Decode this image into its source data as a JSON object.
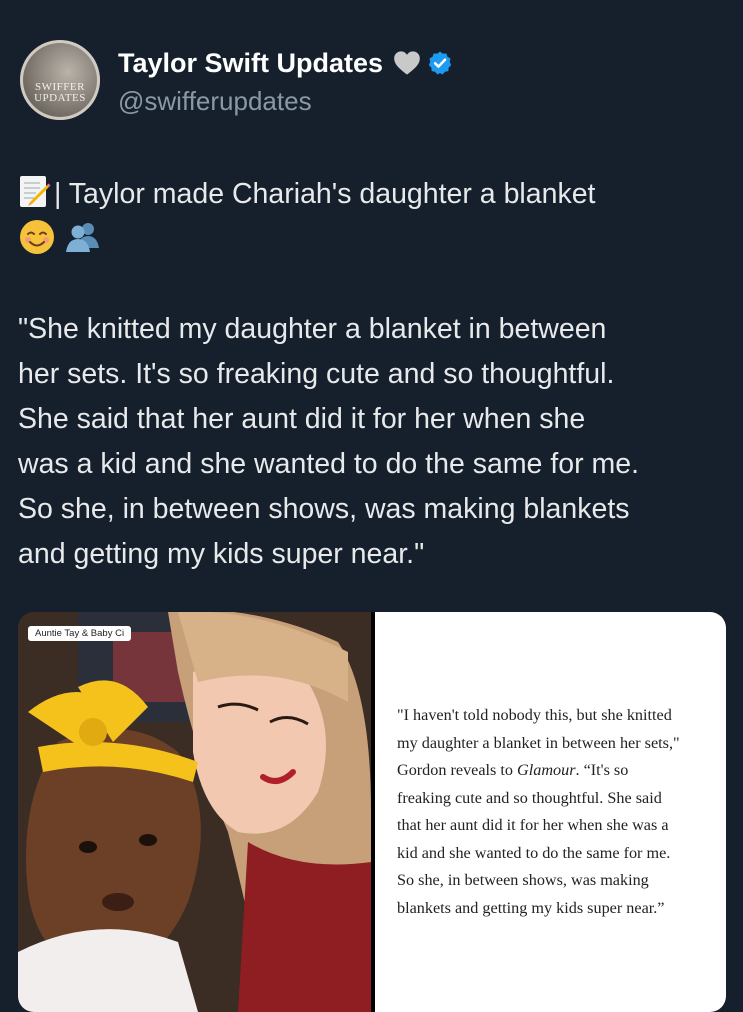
{
  "account": {
    "avatar_text": "SWIFFER UPDATES",
    "display_name": "Taylor Swift Updates",
    "handle": "@swifferupdates",
    "badge_icons": [
      "grey-heart-icon",
      "verified-badge-icon"
    ]
  },
  "tweet": {
    "line1_text": "| Taylor made Chariah's daughter a blanket",
    "line1_icon": "memo-icon",
    "line2_emojis": [
      "smiling-face-icon",
      "busts-in-silhouette-icon"
    ],
    "quote_lines": [
      "\"She knitted my daughter a blanket in between",
      "her sets. It's so freaking cute and so thoughtful.",
      "She said that her aunt did it for her when she",
      "was a kid and she wanted to do the same for me.",
      "So she, in between shows, was making blankets",
      "and getting my kids super near.\""
    ]
  },
  "media": {
    "photo_label": "Auntie Tay & Baby Ci",
    "article_quote": {
      "line1": "\"I haven't told nobody this, but she knitted",
      "line2": "my daughter a blanket in between her sets,\"",
      "line3_a": "Gordon reveals to ",
      "line3_italic": "Glamour",
      "line3_b": ". “It's so",
      "line4": "freaking cute and so thoughtful. She said",
      "line5": "that her aunt did it for her when she was a",
      "line6": "kid and she wanted to do the same for me.",
      "line7": "So she, in between shows, was making",
      "line8": "blankets and getting my kids super near.”"
    }
  },
  "colors": {
    "background": "#16202d",
    "text": "#e7e9ea",
    "handle": "#8b98a5",
    "verified": "#1d9bf0"
  }
}
